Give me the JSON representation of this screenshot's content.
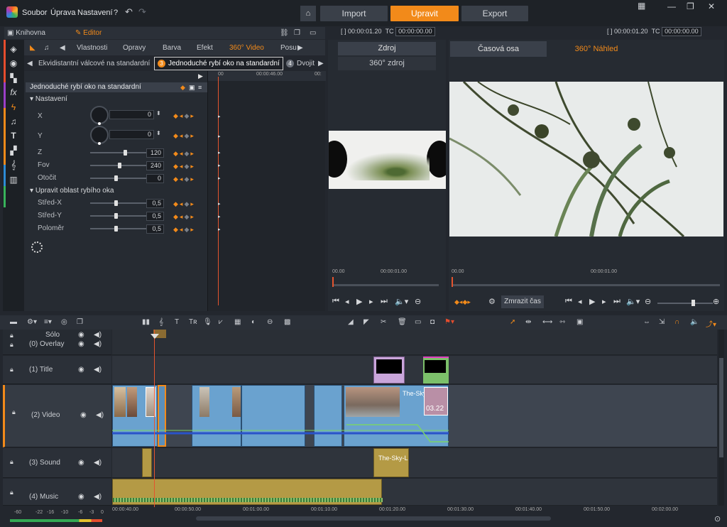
{
  "menu": {
    "file": "Soubor",
    "edit": "Úprava",
    "settings": "Nastavení",
    "help": "?"
  },
  "modes": {
    "import": "Import",
    "edit": "Upravit",
    "export": "Export"
  },
  "left_panel": {
    "library_tab": "Knihovna",
    "editor_tab": "Editor",
    "prop_tabs": [
      "Vlastnosti",
      "Opravy",
      "Barva",
      "Efekt",
      "360° Video",
      "Posu"
    ],
    "subtabs": [
      "Ekvidistantní válcové na standardní",
      "Jednoduché rybí oko na standardní",
      "Dvojit"
    ],
    "subtab_badges": [
      "3",
      "4"
    ],
    "effect_title": "Jednoduché rybí oko na standardní",
    "section_settings": "Nastavení",
    "section_fisheye": "Upravit oblast rybího oka",
    "params": [
      {
        "label": "X",
        "value": "0"
      },
      {
        "label": "Y",
        "value": "0"
      },
      {
        "label": "Z",
        "value": "120"
      },
      {
        "label": "Fov",
        "value": "240"
      },
      {
        "label": "Otočit",
        "value": "0"
      },
      {
        "label": "Střed-X",
        "value": "0,5"
      },
      {
        "label": "Střed-Y",
        "value": "0,5"
      },
      {
        "label": "Poloměr",
        "value": "0,5"
      }
    ],
    "kf_ruler": {
      "start": "00",
      "mid": "00:00:46.00",
      "end": "00:"
    }
  },
  "source_pane": {
    "timecode": "[ ] 00:00:01.20",
    "tc_label": "TC",
    "tc_value": "00:00:00.00",
    "tab": "Zdroj",
    "subtab": "360° zdroj",
    "ruler_start": "00.00",
    "ruler_mid": "00:00:01.00"
  },
  "timeline_pane": {
    "timecode": "[ ] 00:00:01.20",
    "tc_label": "TC",
    "tc_value": "00:00:00.00",
    "tab_timeline": "Časová osa",
    "tab_preview": "360° Náhled",
    "ruler_start": "00.00",
    "ruler_mid": "00:00:01.00",
    "freeze_btn": "Zmrazit čas"
  },
  "tracks": {
    "solo": "Sólo",
    "overlay": "(0) Overlay",
    "title": "(1) Title",
    "video": "(2) Video",
    "sound": "(3) Sound",
    "music": "(4) Music"
  },
  "clips": {
    "sky_video": "The-Sky-",
    "sky_counter": "03.22",
    "sky_sound": "The-Sky-L"
  },
  "ruler": [
    "00:00:40.00",
    "00:00:50.00",
    "00:01:00.00",
    "00:01:10.00",
    "00:01:20.00",
    "00:01:30.00",
    "00:01:40.00",
    "00:01:50.00",
    "00:02:00.00"
  ],
  "vu_labels": [
    "-60",
    "-22",
    "-16",
    "-10",
    "-6",
    "-3",
    "0"
  ],
  "colors": {
    "accent": "#f28a1a",
    "video_clip": "#6aa2cf",
    "audio_clip": "#b49a45"
  }
}
